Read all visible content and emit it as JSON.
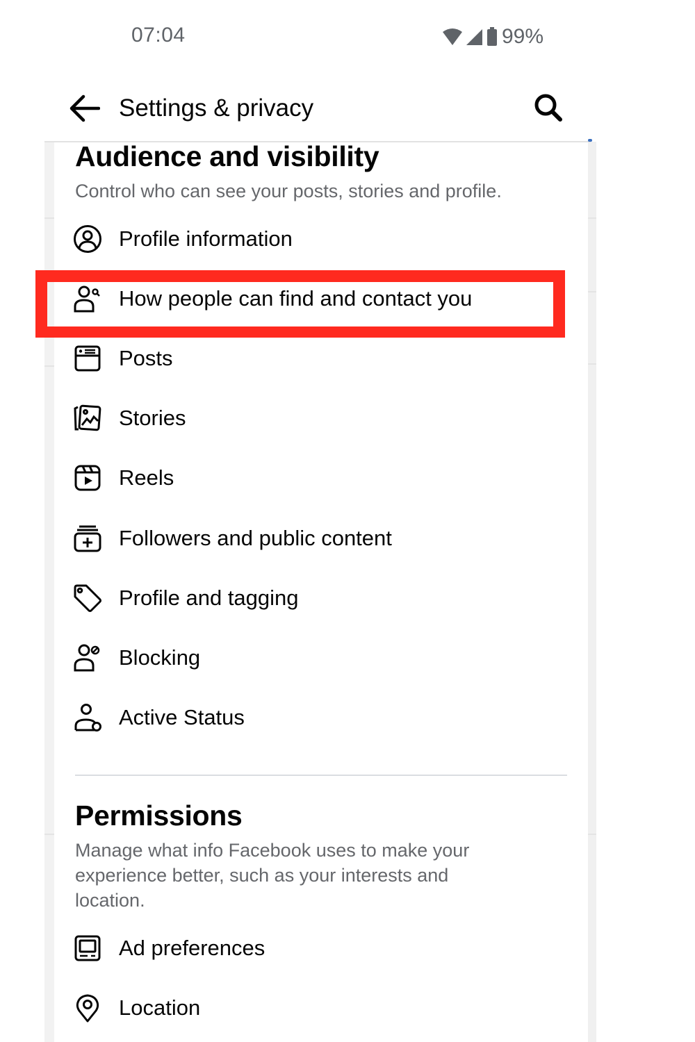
{
  "status_bar": {
    "time": "07:04",
    "battery_percent": "99%",
    "icons": [
      "wifi-icon",
      "cellular-signal-icon",
      "battery-icon"
    ]
  },
  "header": {
    "title": "Settings & privacy",
    "back_icon": "arrow-left-icon",
    "search_icon": "search-icon"
  },
  "sections": [
    {
      "title": "Audience and visibility",
      "description": "Control who can see your posts, stories and profile.",
      "items": [
        {
          "label": "Profile information",
          "icon": "user-circle-icon"
        },
        {
          "label": "How people can find and contact you",
          "icon": "user-search-icon",
          "highlighted": true
        },
        {
          "label": "Posts",
          "icon": "post-card-icon"
        },
        {
          "label": "Stories",
          "icon": "stories-gallery-icon"
        },
        {
          "label": "Reels",
          "icon": "reels-clapper-icon"
        },
        {
          "label": "Followers and public content",
          "icon": "followers-stack-plus-icon"
        },
        {
          "label": "Profile and tagging",
          "icon": "tag-icon"
        },
        {
          "label": "Blocking",
          "icon": "user-block-icon"
        },
        {
          "label": "Active Status",
          "icon": "user-active-status-icon"
        }
      ]
    },
    {
      "title": "Permissions",
      "description": "Manage what info Facebook uses to make your experience better, such as your interests and location.",
      "items": [
        {
          "label": "Ad preferences",
          "icon": "ad-monitor-icon"
        },
        {
          "label": "Location",
          "icon": "location-pin-icon"
        }
      ]
    }
  ],
  "annotation": {
    "highlight_color": "#ff2a1f",
    "highlighted_item": "How people can find and contact you"
  }
}
